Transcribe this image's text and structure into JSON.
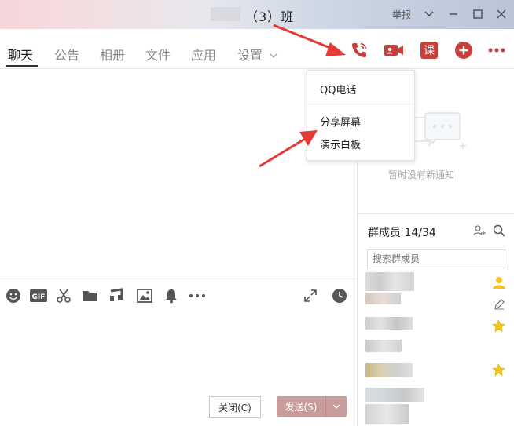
{
  "window": {
    "title": "（3）班",
    "report_label": "举报"
  },
  "tabs": [
    {
      "label": "聊天",
      "active": true
    },
    {
      "label": "公告"
    },
    {
      "label": "相册"
    },
    {
      "label": "文件"
    },
    {
      "label": "应用"
    },
    {
      "label": "设置"
    }
  ],
  "actions": {
    "phone_icon": "phone-icon",
    "video_icon": "video-icon",
    "class_label": "课",
    "add_icon": "plus-circle-icon",
    "more_icon": "more-icon"
  },
  "call_menu": {
    "items": [
      "QQ电话",
      "分享屏幕",
      "演示白板"
    ]
  },
  "notice": {
    "empty_text": "暂时没有新通知"
  },
  "members": {
    "title": "群成员 14/34",
    "search_placeholder": "搜索群成员"
  },
  "buttons": {
    "close": "关闭(C)",
    "send": "发送(S)"
  },
  "colors": {
    "accent_red": "#c9403a",
    "send_bg": "#c79c9a",
    "annotation_arrow": "#e53935",
    "star": "#f5c518"
  }
}
